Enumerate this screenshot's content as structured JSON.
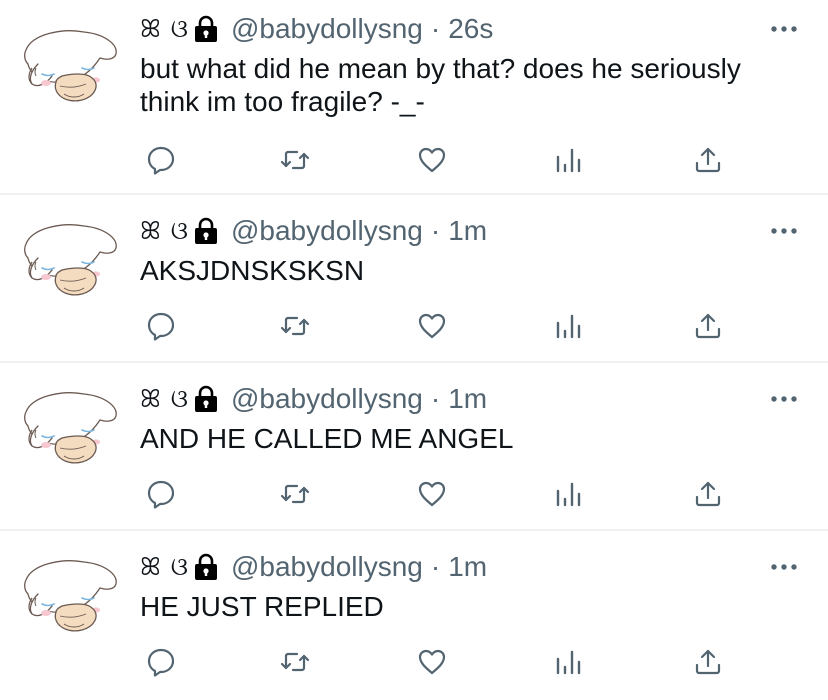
{
  "colors": {
    "text": "#0f1419",
    "secondary": "#536471",
    "divider": "#eff1f3"
  },
  "icons": {
    "more": "more-horizontal-icon",
    "reply": "reply-icon",
    "retweet": "retweet-icon",
    "like": "heart-icon",
    "analytics": "analytics-icon",
    "share": "share-icon",
    "lock": "lock-icon"
  },
  "tweets": [
    {
      "display_name": "ꕤ ଓ",
      "handle": "@babydollysng",
      "separator": "·",
      "time": "26s",
      "text": "but what did he mean by that? does he seriously think im too fragile? -_-"
    },
    {
      "display_name": "ꕤ ଓ",
      "handle": "@babydollysng",
      "separator": "·",
      "time": "1m",
      "text": "AKSJDNSKSKSN"
    },
    {
      "display_name": "ꕤ ଓ",
      "handle": "@babydollysng",
      "separator": "·",
      "time": "1m",
      "text": "AND HE CALLED ME ANGEL"
    },
    {
      "display_name": "ꕤ ଓ",
      "handle": "@babydollysng",
      "separator": "·",
      "time": "1m",
      "text": "HE JUST REPLIED"
    }
  ]
}
